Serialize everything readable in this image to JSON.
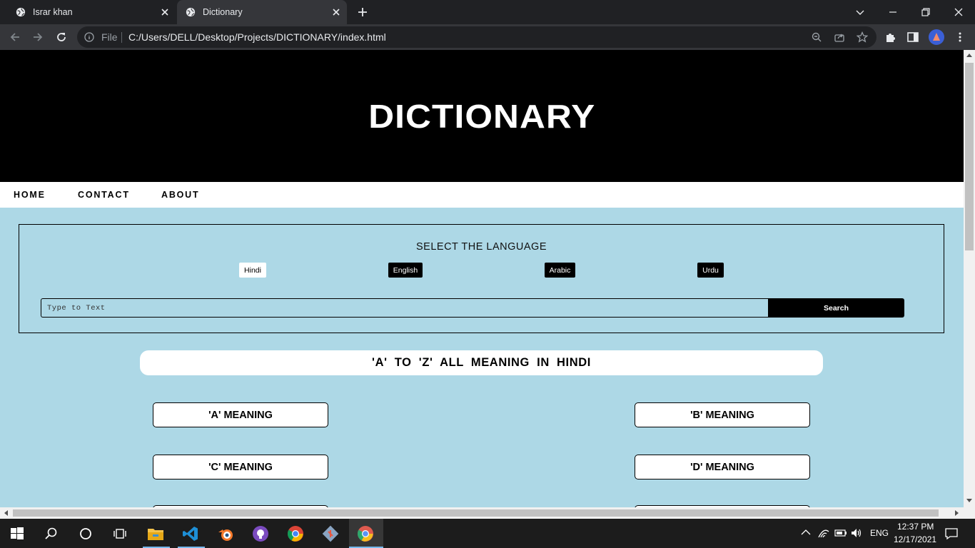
{
  "browser": {
    "tabs": [
      {
        "title": "Israr khan",
        "active": false
      },
      {
        "title": "Dictionary",
        "active": true
      }
    ],
    "omnibox": {
      "scheme_label": "File",
      "url": "C:/Users/DELL/Desktop/Projects/DICTIONARY/index.html"
    }
  },
  "page": {
    "title": "DICTIONARY",
    "nav": [
      "HOME",
      "CONTACT",
      "ABOUT"
    ],
    "language_section": {
      "heading": "SELECT THE LANGUAGE",
      "languages": [
        {
          "label": "Hindi",
          "selected": true
        },
        {
          "label": "English",
          "selected": false
        },
        {
          "label": "Arabic",
          "selected": false
        },
        {
          "label": "Urdu",
          "selected": false
        }
      ],
      "search_placeholder": "Type to Text",
      "search_button": "Search"
    },
    "banner": "'A' TO 'Z' ALL MEANING IN HINDI",
    "meanings": [
      "'A' MEANING",
      "'B' MEANING",
      "'C' MEANING",
      "'D' MEANING"
    ]
  },
  "colors": {
    "page_bg": "#add8e6",
    "header_bg": "#000000",
    "chrome_dark": "#202124",
    "chrome_toolbar": "#35363a"
  },
  "taskbar": {
    "apps": [
      "start-icon",
      "search-icon",
      "cortana-icon",
      "task-view-icon",
      "file-explorer-icon",
      "vscode-icon",
      "blender-icon",
      "github-desktop-icon",
      "chrome-icon",
      "git-icon",
      "chrome-canary-icon"
    ],
    "tray": {
      "language": "ENG",
      "time": "12:37 PM",
      "date": "12/17/2021"
    }
  }
}
